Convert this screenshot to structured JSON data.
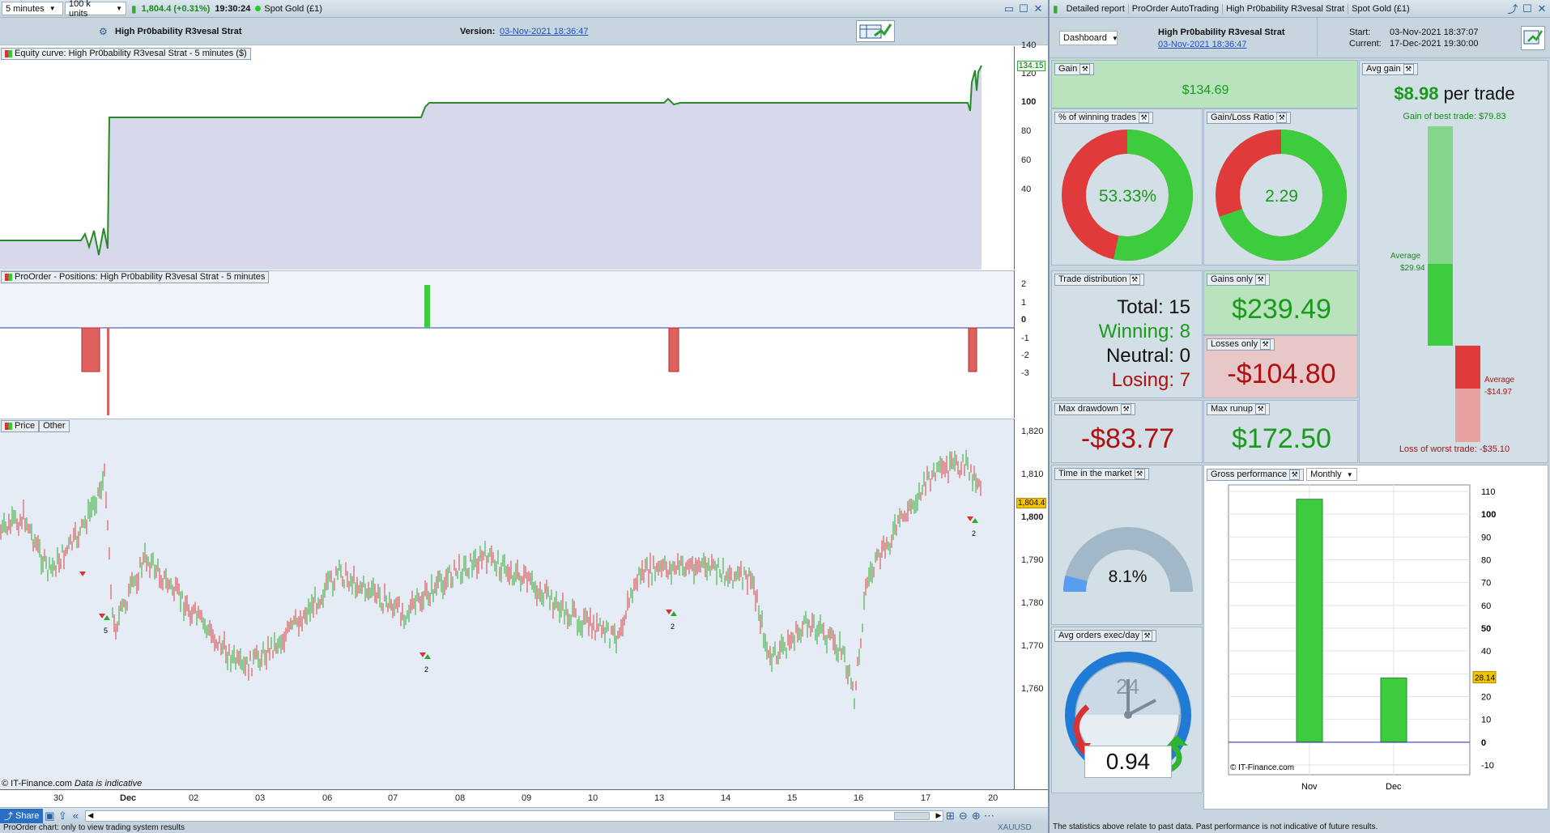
{
  "left": {
    "timeframe": "5 minutes",
    "units": "100 k units",
    "last_price": "1,804.4 (+0.31%)",
    "time": "19:30:24",
    "instrument": "Spot Gold (£1)",
    "strategy_name": "High Pr0bability R3vesal Strat",
    "version_label": "Version:",
    "version_date": "03-Nov-2021 18:36:47",
    "equity": {
      "title": "Equity curve: High Pr0bability R3vesal Strat - 5 minutes ($)",
      "last_value": "134.15",
      "ticks": [
        "140",
        "120",
        "100",
        "80",
        "60",
        "40"
      ]
    },
    "positions": {
      "title": "ProOrder - Positions: High Pr0bability R3vesal Strat - 5 minutes",
      "ticks": [
        "2",
        "1",
        "0",
        "-1",
        "-2",
        "-3"
      ]
    },
    "price": {
      "tab_price": "Price",
      "tab_other": "Other",
      "current": "1,804.4",
      "ticks": [
        "1,820",
        "1,810",
        "1,800",
        "1,790",
        "1,780",
        "1,770",
        "1,760"
      ],
      "markers": [
        "5",
        "2",
        "2",
        "2"
      ]
    },
    "copyright": "© IT-Finance.com",
    "indicative": "Data is indicative",
    "dates": [
      "30",
      "Dec",
      "02",
      "03",
      "06",
      "07",
      "08",
      "09",
      "10",
      "13",
      "14",
      "15",
      "16",
      "17",
      "20"
    ],
    "share_label": "Share",
    "status_text": "ProOrder chart: only to view trading system results",
    "status_right": "XAUUSD"
  },
  "right": {
    "tabs": [
      "Detailed report",
      "ProOrder AutoTrading",
      "High Pr0bability R3vesal Strat",
      "Spot Gold (£1)"
    ],
    "dashboard_label": "Dashboard",
    "strategy_name": "High Pr0bability R3vesal Strat",
    "strategy_date": "03-Nov-2021 18:36:47",
    "start_label": "Start:",
    "start_value": "03-Nov-2021 18:37:07",
    "current_label": "Current:",
    "current_value": "17-Dec-2021 19:30:00",
    "gain": {
      "title": "Gain",
      "value": "$134.69"
    },
    "avg_gain": {
      "title": "Avg gain",
      "value": "$8.98",
      "suffix": "per trade",
      "best": "Gain of best trade: $79.83",
      "avg_label": "Average",
      "avg_pos": "$29.94",
      "avg_label2": "Average",
      "avg_neg": "-$14.97",
      "worst": "Loss of worst trade: -$35.10",
      "best_fraction": 0.6,
      "avg_pos_fraction": 0.6,
      "avg_neg_fraction": 0.3
    },
    "win_pct": {
      "title": "% of winning trades",
      "value": "53.33%",
      "fraction": 0.5333
    },
    "gl_ratio": {
      "title": "Gain/Loss Ratio",
      "value": "2.29",
      "fraction": 0.696
    },
    "trade_dist": {
      "title": "Trade distribution",
      "total": "Total: 15",
      "winning": "Winning: 8",
      "neutral": "Neutral: 0",
      "losing": "Losing: 7"
    },
    "gains_only": {
      "title": "Gains only",
      "value": "$239.49"
    },
    "losses_only": {
      "title": "Losses only",
      "value": "-$104.80"
    },
    "max_drawdown": {
      "title": "Max drawdown",
      "value": "-$83.77"
    },
    "max_runup": {
      "title": "Max runup",
      "value": "$172.50"
    },
    "time_in_market": {
      "title": "Time in the market",
      "value": "8.1%",
      "fraction": 0.081
    },
    "avg_orders": {
      "title": "Avg orders exec/day",
      "value": "0.94",
      "clock": "24"
    },
    "gross": {
      "title": "Gross performance",
      "period": "Monthly",
      "copyright": "© IT-Finance.com",
      "current_label": "28.14",
      "ticks": [
        "110",
        "100",
        "90",
        "80",
        "70",
        "60",
        "50",
        "40",
        "30",
        "20",
        "10",
        "0",
        "-10"
      ]
    },
    "disclaimer": "The statistics above relate to past data. Past performance is not indicative of future results."
  },
  "chart_data": [
    {
      "type": "bar",
      "title": "Gross performance",
      "categories": [
        "Nov",
        "Dec"
      ],
      "values": [
        106.55,
        28.14
      ],
      "ylim": [
        -10,
        110
      ]
    },
    {
      "type": "pie",
      "title": "% of winning trades",
      "categories": [
        "Winning",
        "Losing"
      ],
      "values": [
        53.33,
        46.67
      ]
    }
  ],
  "colors": {
    "green": "#3dcc3d",
    "red": "#e03a3a",
    "darkred": "#b01010",
    "axisbg": "#d3dfe7"
  }
}
